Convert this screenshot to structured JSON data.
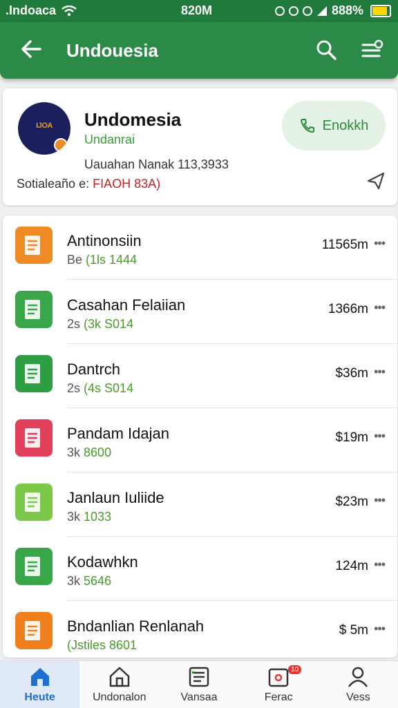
{
  "status": {
    "carrier": ".Indoaca",
    "time": "820M",
    "battery": "888%"
  },
  "appbar": {
    "title": "Undouesia"
  },
  "profile": {
    "logo_text": "IJOA",
    "name": "Undomesia",
    "subtitle": "Undanrai",
    "meta1": "Uauahan Nanak 113,3933",
    "meta2_label": "Sotialeaño e:",
    "meta2_value": "FIAOH 83A)",
    "action_label": "Enokkh"
  },
  "list": [
    {
      "title": "Antinonsiin",
      "sub_prefix": "Be",
      "sub_green": "(1ls 1444",
      "amount": "11565m",
      "icon": "folder-orange-icon",
      "color": "#f08a24"
    },
    {
      "title": "Casahan Felaiian",
      "sub_prefix": "2s",
      "sub_green": "(3k S014",
      "amount": "1366m",
      "icon": "folder-green-icon",
      "color": "#3aa64a"
    },
    {
      "title": "Dantrch",
      "sub_prefix": "2s",
      "sub_green": "(4s S014",
      "amount": "$36m",
      "icon": "document-green-icon",
      "color": "#2e9e45"
    },
    {
      "title": "Pandam Idajan",
      "sub_prefix": "3k",
      "sub_green": "8600",
      "amount": "$19m",
      "icon": "document-red-icon",
      "color": "#e0405a"
    },
    {
      "title": "Janlaun Iuliide",
      "sub_prefix": "3k",
      "sub_green": "1033",
      "amount": "$23m",
      "icon": "document-lime-icon",
      "color": "#7cc84a"
    },
    {
      "title": "Kodawhkn",
      "sub_prefix": "3k",
      "sub_green": "5646",
      "amount": "124m",
      "icon": "document-green2-icon",
      "color": "#3aa64a"
    },
    {
      "title": "Bndanlian Renlanah",
      "sub_prefix": "",
      "sub_green": "(Jstiles 8601",
      "amount": "$ 5m",
      "icon": "document-orange-icon",
      "color": "#f0801e"
    }
  ],
  "nav": [
    {
      "label": "Heute",
      "icon": "home-icon"
    },
    {
      "label": "Undonalon",
      "icon": "building-icon"
    },
    {
      "label": "Vansaa",
      "icon": "list-icon"
    },
    {
      "label": "Ferac",
      "icon": "inbox-icon",
      "badge": "10"
    },
    {
      "label": "Vess",
      "icon": "person-icon"
    }
  ]
}
